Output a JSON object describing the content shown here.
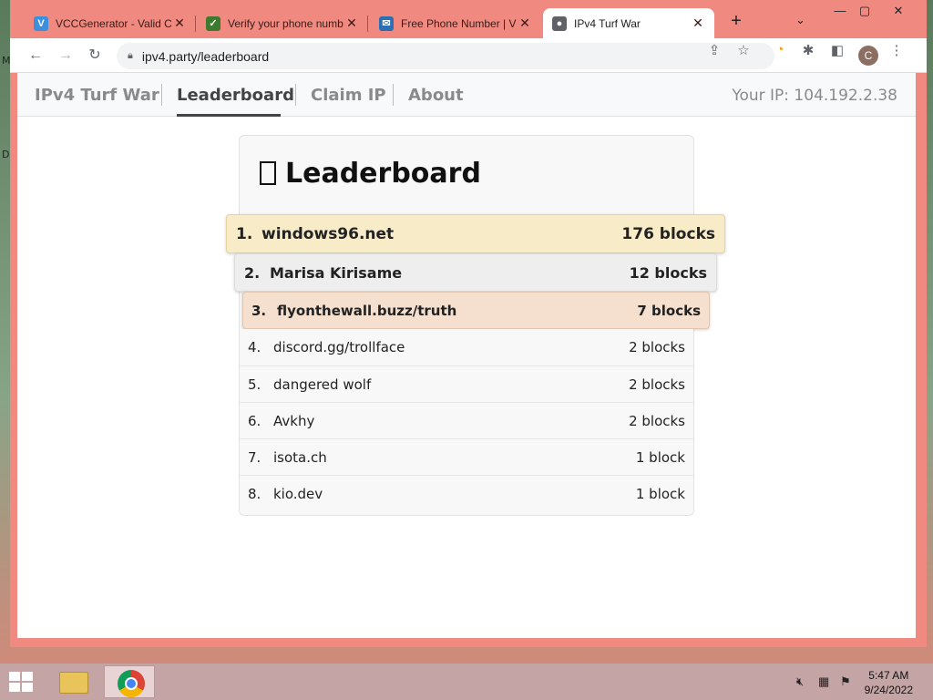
{
  "desktop": {
    "letters": [
      "M",
      "D"
    ]
  },
  "tabs": [
    {
      "title": "VCCGenerator - Valid C",
      "favicon_glyph": "V",
      "favicon_color": "#3b8fdc",
      "active": false
    },
    {
      "title": "Verify your phone numb",
      "favicon_glyph": "✓",
      "favicon_color": "#3d7a2e",
      "active": false
    },
    {
      "title": "Free Phone Number | V",
      "favicon_glyph": "✉",
      "favicon_color": "#2d6fb3",
      "active": false
    },
    {
      "title": "IPv4 Turf War",
      "favicon_glyph": "●",
      "favicon_color": "#5f6368",
      "active": true
    }
  ],
  "toolbar": {
    "url": "ipv4.party/leaderboard",
    "profile_initial": "C"
  },
  "site": {
    "nav": {
      "brand": "IPv4 Turf War",
      "leaderboard": "Leaderboard",
      "claim": "Claim IP",
      "about": "About"
    },
    "your_ip": "Your IP: 104.192.2.38",
    "title": "Leaderboard",
    "leaderboard": [
      {
        "rank": "1.",
        "name": "windows96.net",
        "blocks": "176 blocks"
      },
      {
        "rank": "2.",
        "name": "Marisa Kirisame",
        "blocks": "12 blocks"
      },
      {
        "rank": "3.",
        "name": "flyonthewall.buzz/truth",
        "blocks": "7 blocks"
      },
      {
        "rank": "4.",
        "name": "discord.gg/trollface",
        "blocks": "2 blocks"
      },
      {
        "rank": "5.",
        "name": "dangered wolf",
        "blocks": "2 blocks"
      },
      {
        "rank": "6.",
        "name": "Avkhy",
        "blocks": "2 blocks"
      },
      {
        "rank": "7.",
        "name": "isota.ch",
        "blocks": "1 block"
      },
      {
        "rank": "8.",
        "name": "kio.dev",
        "blocks": "1 block"
      }
    ]
  },
  "taskbar": {
    "time": "5:47 AM",
    "date": "9/24/2022"
  }
}
